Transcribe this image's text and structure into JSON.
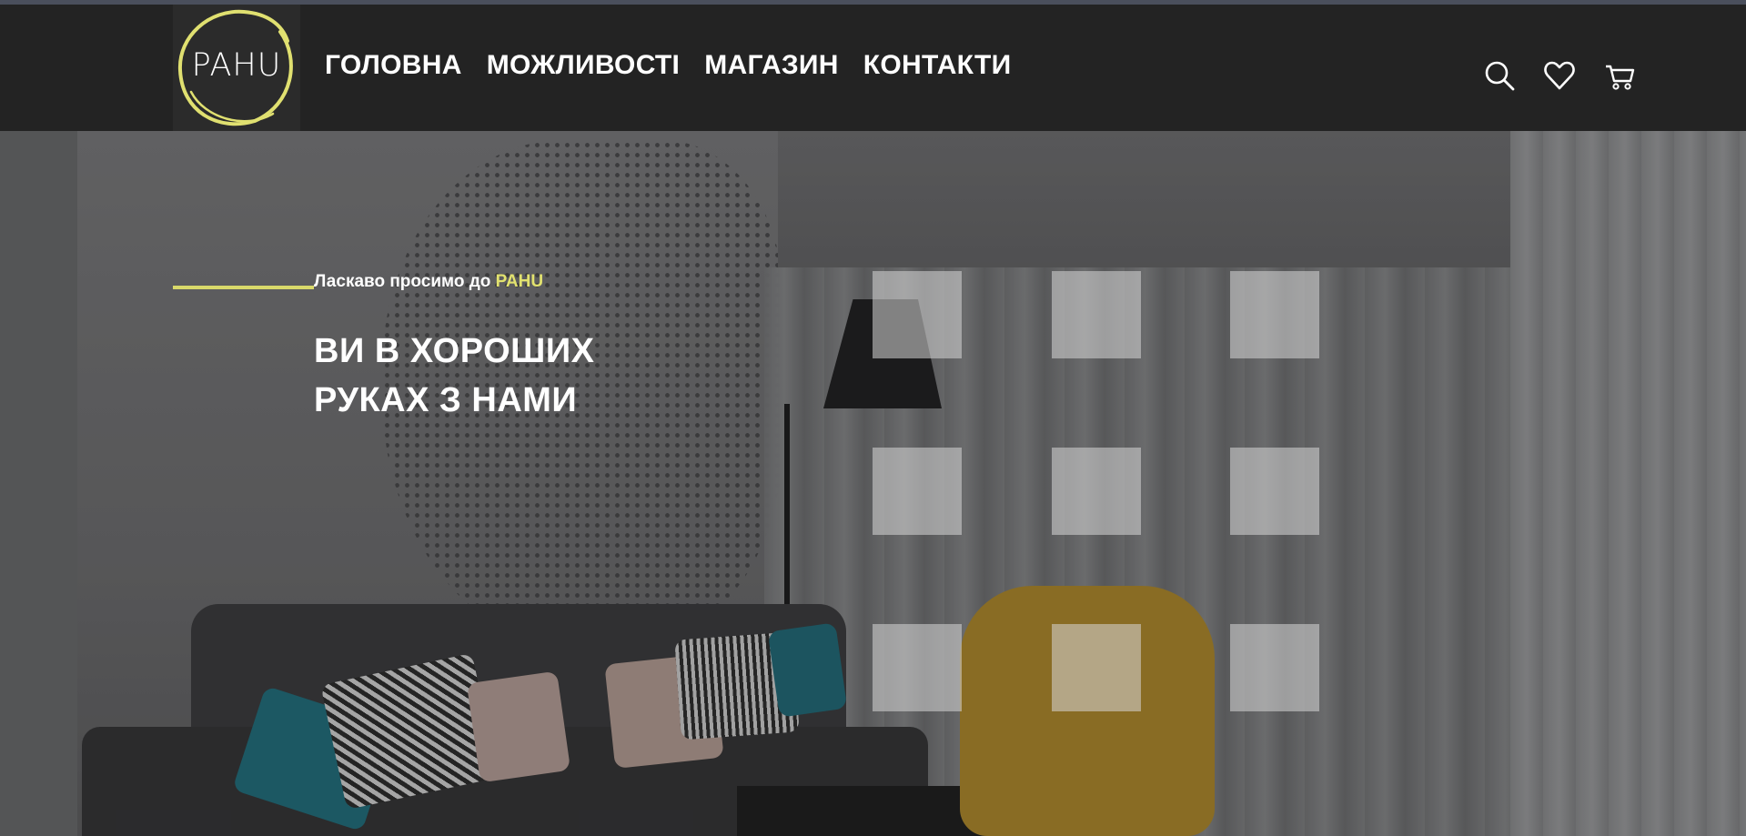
{
  "logo": {
    "text": "PAHU",
    "ring_color": "#e0e070"
  },
  "nav": {
    "links": [
      "ГОЛОВНА",
      "МОЖЛИВОСТІ",
      "МАГАЗИН",
      "КОНТАКТИ"
    ],
    "icons": [
      "search-icon",
      "heart-icon",
      "cart-icon"
    ]
  },
  "hero": {
    "welcome_prefix": "Ласкаво просимо до",
    "welcome_brand": "PAHU",
    "headline_line1": "ВИ В ХОРОШИХ",
    "headline_line2": "РУКАХ З НАМИ",
    "accent_color": "#d9d96a",
    "grid_squares": 9
  }
}
